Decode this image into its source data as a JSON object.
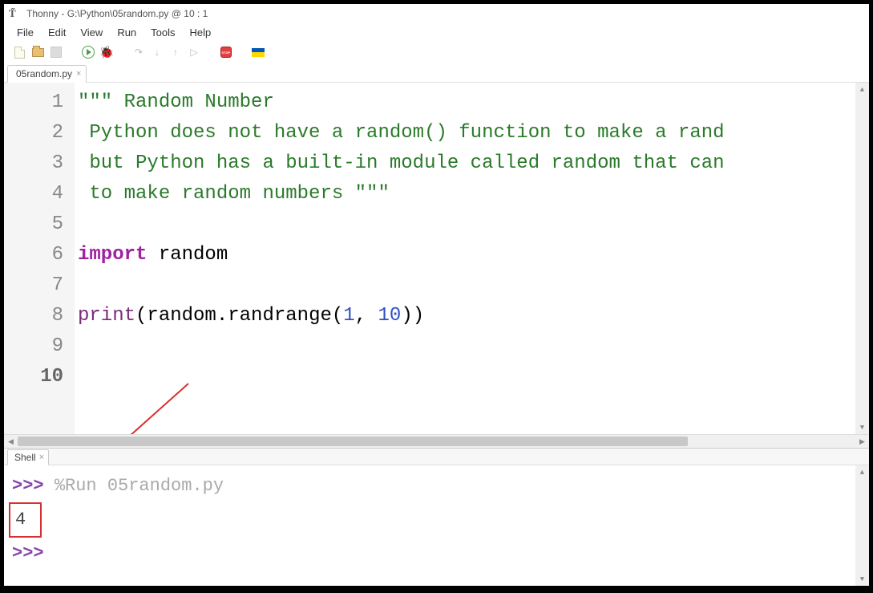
{
  "title": "Thonny  -  G:\\Python\\05random.py  @  10 : 1",
  "menu": {
    "file": "File",
    "edit": "Edit",
    "view": "View",
    "run": "Run",
    "tools": "Tools",
    "help": "Help"
  },
  "tab": {
    "name": "05random.py"
  },
  "shell_tab": {
    "name": "Shell"
  },
  "code": {
    "l1a": "\"\"\" ",
    "l1b": "Random Number",
    "l2": " Python does not have a random() function to make a rand",
    "l3": " but Python has a built-in module called random that can",
    "l4a": " to make random numbers ",
    "l4b": "\"\"\"",
    "l5": "",
    "l6a": "import",
    "l6b": " random",
    "l7": "",
    "l8a": "print",
    "l8b": "(",
    "l8c": "random",
    "l8d": ".",
    "l8e": "randrange",
    "l8f": "(",
    "l8g": "1",
    "l8h": ", ",
    "l8i": "10",
    "l8j": ")",
    "l8k": ")",
    "l9": ""
  },
  "gutter": {
    "n1": "1",
    "n2": "2",
    "n3": "3",
    "n4": "4",
    "n5": "5",
    "n6": "6",
    "n7": "7",
    "n8": "8",
    "n9": "9",
    "n10": "10"
  },
  "shell": {
    "prompt": ">>> ",
    "run_cmd": "%Run 05random.py",
    "output": "4",
    "prompt2": ">>> "
  },
  "icons": {
    "stop": "STOP"
  }
}
